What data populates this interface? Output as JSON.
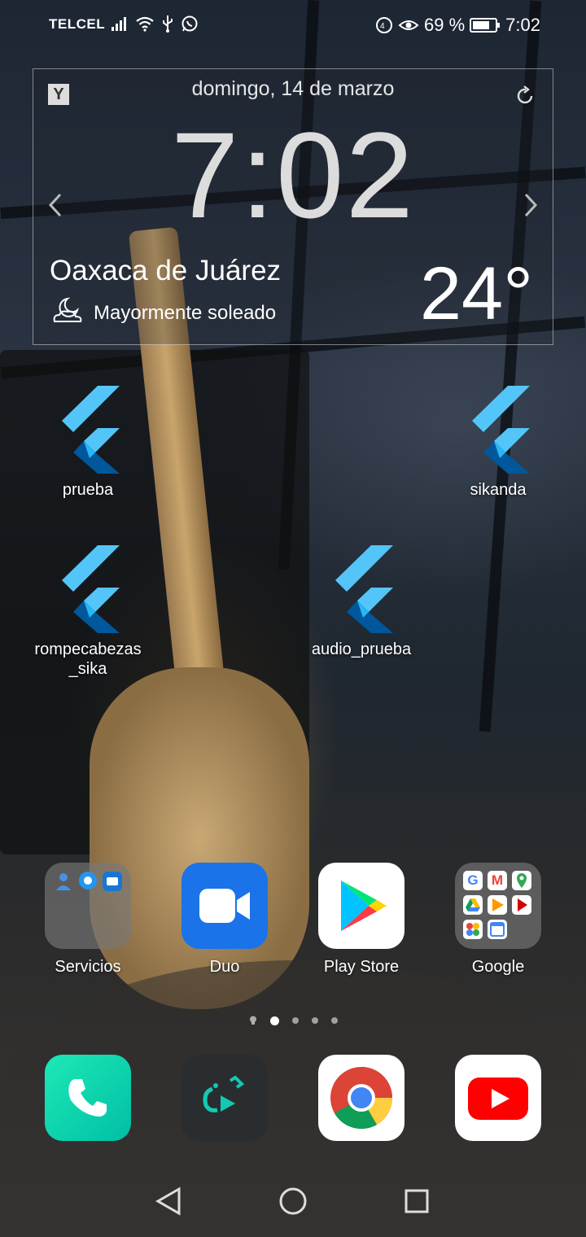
{
  "status_bar": {
    "carrier": "TELCEL",
    "battery_percent": "69 %",
    "time": "7:02"
  },
  "clock_widget": {
    "logo": "Y",
    "date": "domingo, 14 de marzo",
    "time": "7:02",
    "city": "Oaxaca de Juárez",
    "condition": "Mayormente soleado",
    "temperature": "24°"
  },
  "home_apps": [
    {
      "label": "prueba",
      "icon": "flutter-icon"
    },
    {
      "label": "sikanda",
      "icon": "flutter-icon"
    },
    {
      "label": "rompecabezas\n_sika",
      "icon": "flutter-icon"
    },
    {
      "label": "audio_prueba",
      "icon": "flutter-icon"
    }
  ],
  "dock_top": [
    {
      "label": "Servicios",
      "icon": "folder-icon"
    },
    {
      "label": "Duo",
      "icon": "duo-icon"
    },
    {
      "label": "Play Store",
      "icon": "play-store-icon"
    },
    {
      "label": "Google",
      "icon": "google-folder-icon"
    }
  ],
  "page_indicator": {
    "pages": 4,
    "current": 1
  },
  "dock_bottom": [
    {
      "name": "Teléfono",
      "icon": "phone-icon"
    },
    {
      "name": "Game",
      "icon": "game-icon"
    },
    {
      "name": "Chrome",
      "icon": "chrome-icon"
    },
    {
      "name": "YouTube",
      "icon": "youtube-icon"
    }
  ],
  "colors": {
    "flutter_light": "#54C5F8",
    "flutter_dark": "#01579B",
    "duo_blue": "#1A73E8",
    "phone_green": "#1DE9B6",
    "youtube_red": "#FF0000"
  }
}
